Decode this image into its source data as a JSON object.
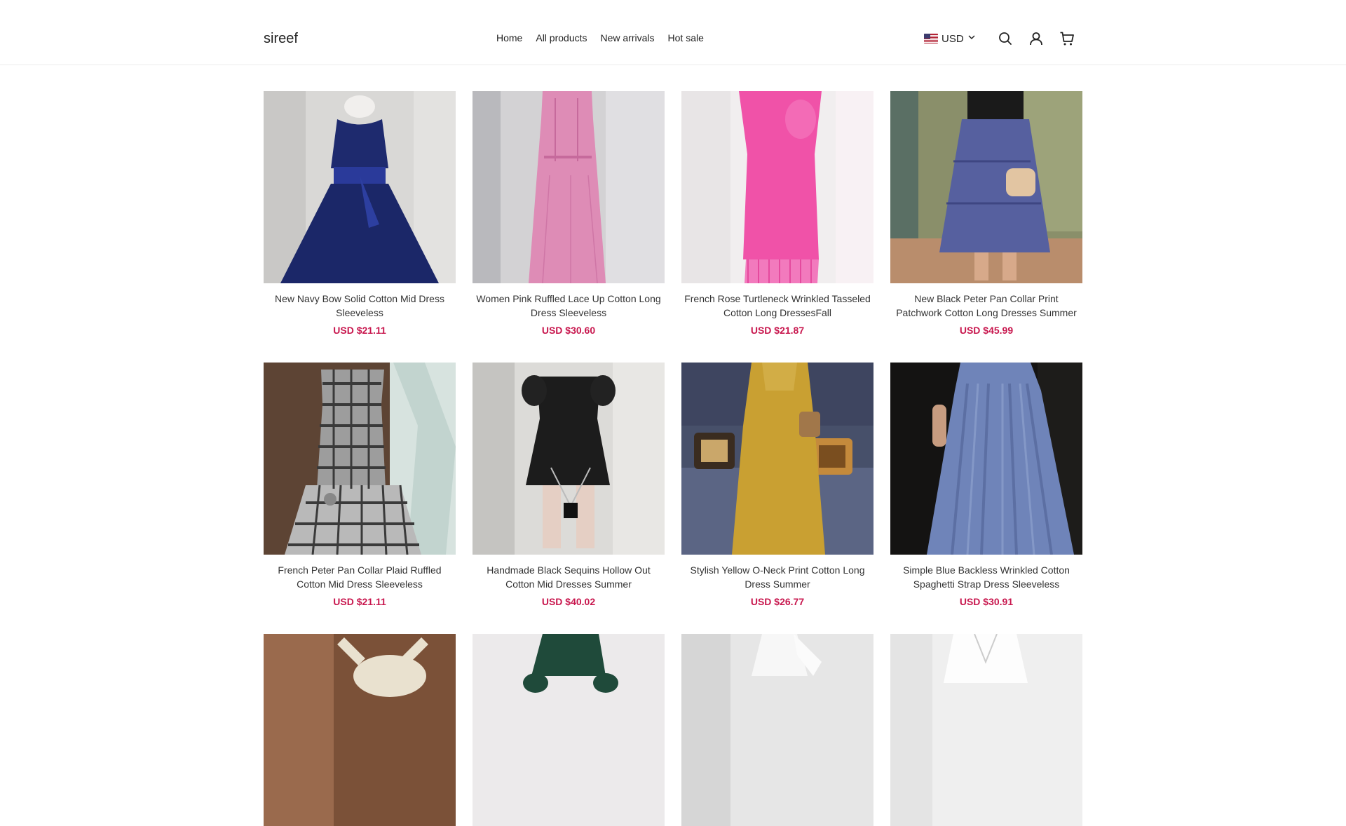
{
  "header": {
    "logo": "sireef",
    "nav": [
      "Home",
      "All products",
      "New arrivals",
      "Hot sale"
    ],
    "currency": "USD",
    "icons": [
      "search-icon",
      "account-icon",
      "cart-icon"
    ]
  },
  "colors": {
    "price": "#c8174e",
    "border": "#ececec"
  },
  "products": [
    {
      "title": "New Navy Bow Solid Cotton Mid Dress Sleeveless",
      "price": "USD $21.11"
    },
    {
      "title": "Women Pink Ruffled Lace Up Cotton Long Dress Sleeveless",
      "price": "USD $30.60"
    },
    {
      "title": "French Rose Turtleneck Wrinkled Tasseled Cotton Long DressesFall",
      "price": "USD $21.87"
    },
    {
      "title": "New Black Peter Pan Collar Print Patchwork Cotton Long Dresses Summer",
      "price": "USD $45.99"
    },
    {
      "title": "French Peter Pan Collar Plaid Ruffled Cotton Mid Dress Sleeveless",
      "price": "USD $21.11"
    },
    {
      "title": "Handmade Black Sequins Hollow Out Cotton Mid Dresses Summer",
      "price": "USD $40.02"
    },
    {
      "title": "Stylish Yellow O-Neck Print Cotton Long Dress Summer",
      "price": "USD $26.77"
    },
    {
      "title": "Simple Blue Backless Wrinkled Cotton Spaghetti Strap Dress Sleeveless",
      "price": "USD $30.91"
    }
  ]
}
